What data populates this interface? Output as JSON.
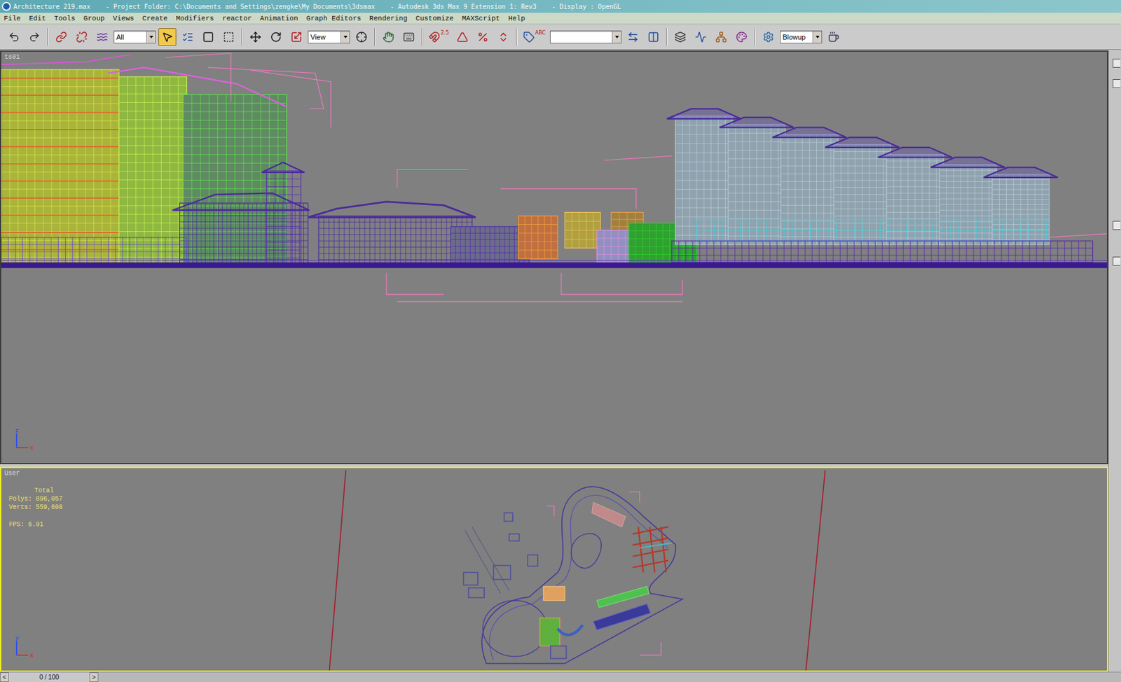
{
  "window": {
    "title": "Architecture 219.max    - Project Folder: C:\\Documents and Settings\\zengke\\My Documents\\3dsmax    - Autodesk 3ds Max 9 Extension 1: Rev3    - Display : OpenGL"
  },
  "menu": [
    "File",
    "Edit",
    "Tools",
    "Group",
    "Views",
    "Create",
    "Modifiers",
    "reactor",
    "Animation",
    "Graph Editors",
    "Rendering",
    "Customize",
    "MAXScript",
    "Help"
  ],
  "toolbar": [
    {
      "kind": "button",
      "selected": false
    },
    {
      "kind": "button",
      "selected": false
    },
    {
      "kind": "separator"
    },
    {
      "kind": "button",
      "selected": false
    },
    {
      "kind": "button",
      "selected": false
    },
    {
      "kind": "button",
      "selected": false
    },
    {
      "kind": "dropdown",
      "value": "All"
    },
    {
      "kind": "button",
      "selected": true
    },
    {
      "kind": "button",
      "selected": false
    },
    {
      "kind": "button",
      "selected": false
    },
    {
      "kind": "button",
      "selected": false
    },
    {
      "kind": "separator"
    },
    {
      "kind": "button",
      "selected": false
    },
    {
      "kind": "button",
      "selected": false
    },
    {
      "kind": "button",
      "selected": false
    },
    {
      "kind": "dropdown",
      "value": "View"
    },
    {
      "kind": "button",
      "selected": false
    },
    {
      "kind": "separator"
    },
    {
      "kind": "button",
      "selected": false
    },
    {
      "kind": "button",
      "selected": false
    },
    {
      "kind": "separator"
    },
    {
      "kind": "button",
      "selected": false,
      "badge": "2.5"
    },
    {
      "kind": "button",
      "selected": false
    },
    {
      "kind": "button",
      "selected": false
    },
    {
      "kind": "button",
      "selected": false
    },
    {
      "kind": "separator"
    },
    {
      "kind": "button",
      "selected": false,
      "badge": "ABC"
    },
    {
      "kind": "combo",
      "value": ""
    },
    {
      "kind": "button",
      "selected": false
    },
    {
      "kind": "button",
      "selected": false
    },
    {
      "kind": "separator"
    },
    {
      "kind": "button",
      "selected": false
    },
    {
      "kind": "button",
      "selected": false
    },
    {
      "kind": "button",
      "selected": false
    },
    {
      "kind": "button",
      "selected": false
    },
    {
      "kind": "separator"
    },
    {
      "kind": "button",
      "selected": false
    },
    {
      "kind": "dropdown",
      "value": "Blowup"
    },
    {
      "kind": "button",
      "selected": false
    }
  ],
  "viewports": [
    {
      "label": "ts01",
      "active": false,
      "axes": {
        "up": "z",
        "right": "x"
      }
    },
    {
      "label": "User",
      "active": true,
      "axes": {
        "up": "y",
        "right": "x"
      },
      "stats": {
        "heading": "Total",
        "rows": [
          {
            "label": "Polys:",
            "value": "896,057"
          },
          {
            "label": "Verts:",
            "value": "559,608"
          }
        ],
        "fps": {
          "label": "FPS:",
          "value": "6.91"
        }
      }
    }
  ],
  "time_slider": {
    "prev": "<",
    "position": "0 / 100",
    "next": ">"
  }
}
